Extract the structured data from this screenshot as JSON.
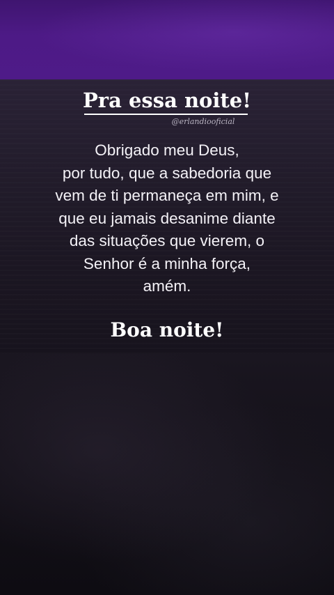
{
  "post": {
    "title": "Pra essa noite!",
    "handle": "@erlandiooficial",
    "message_lines": [
      "Obrigado meu Deus,",
      "por tudo, que a sabedoria que",
      "vem de ti permaneça em mim, e",
      "que eu jamais desanime diante",
      "das situações que vierem, o",
      "Senhor é a minha força,",
      "amém."
    ],
    "closing": "Boa noite!"
  },
  "colors": {
    "sky": "#4d1a86",
    "card": "#221c2b",
    "text": "#ffffff"
  }
}
